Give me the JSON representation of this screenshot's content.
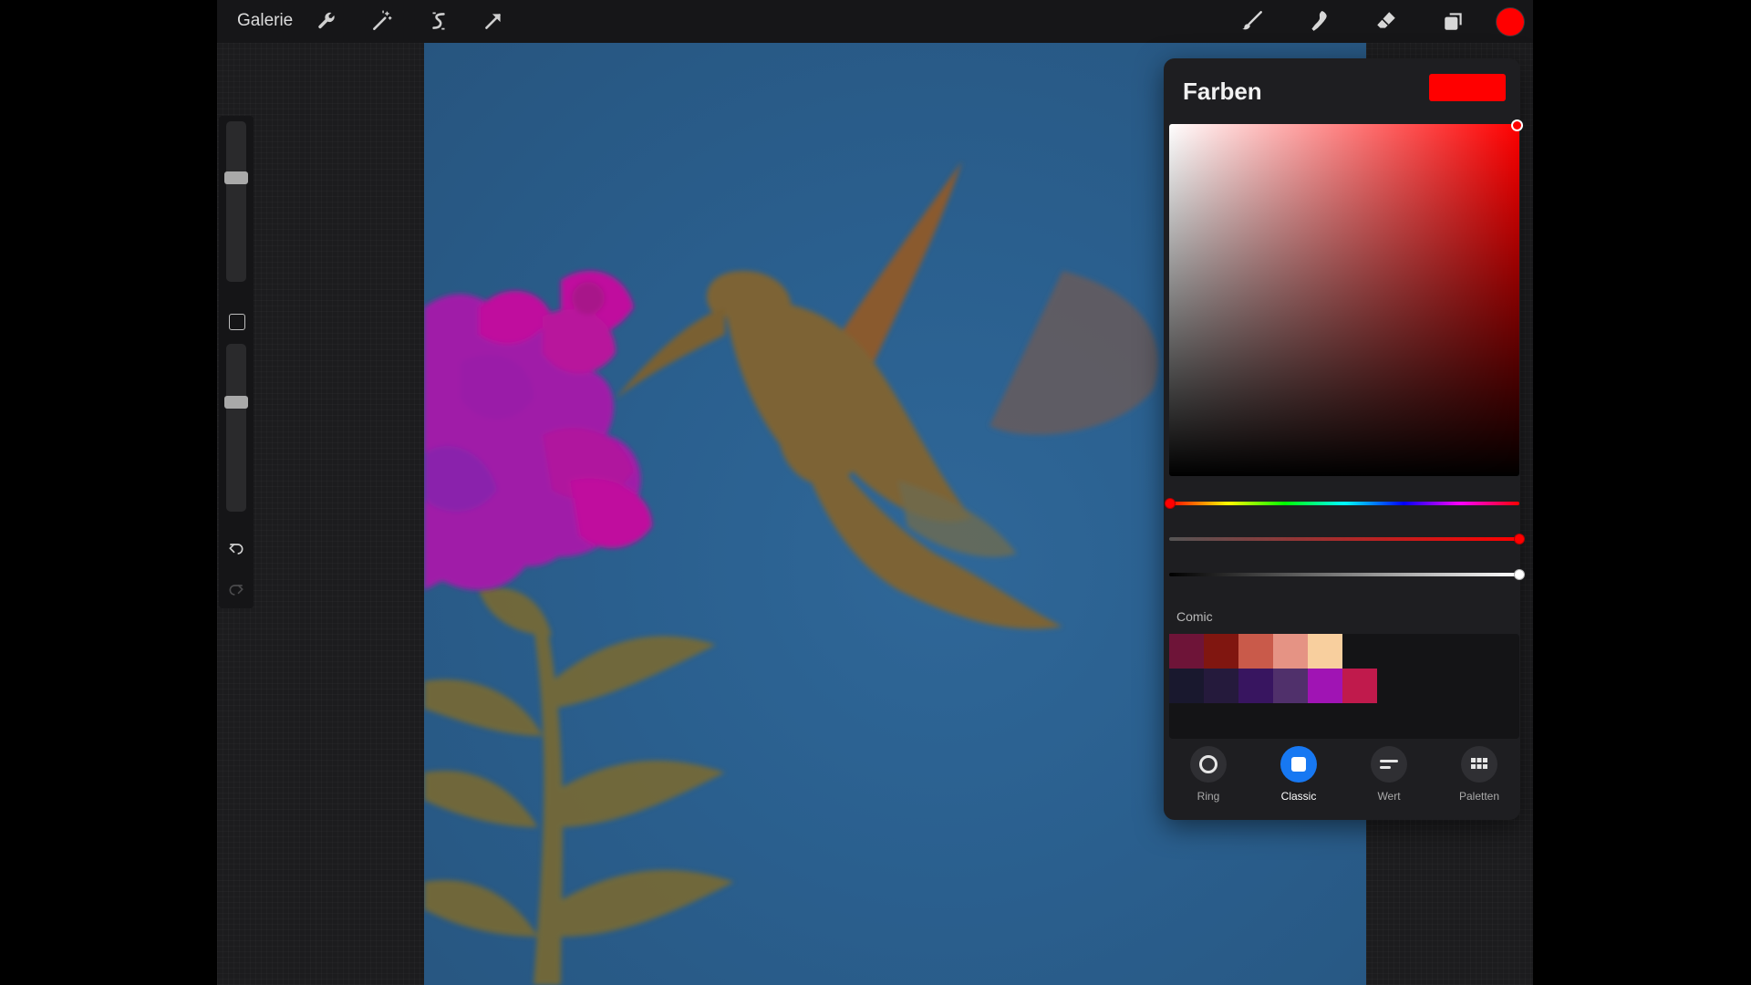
{
  "topbar": {
    "gallery_label": "Galerie",
    "left_tools": [
      "wrench-icon",
      "magic-wand-icon",
      "selection-s-icon",
      "transform-arrow-icon"
    ],
    "right_tools": [
      "brush-icon",
      "smudge-icon",
      "eraser-icon",
      "layers-icon"
    ],
    "current_color": "#ff0000"
  },
  "sidebar": {
    "brush_size_level": 0.35,
    "opacity_level": 0.35
  },
  "color_panel": {
    "title": "Farben",
    "current_color": "#ff0000",
    "hue_color": "#ff0000",
    "saturation": 1.0,
    "brightness": 1.0,
    "hue": 0.0,
    "palette": {
      "name": "Comic",
      "swatches": [
        [
          "#6e1438",
          "#801610",
          "#c95a4a",
          "#e59384",
          "#f8cf9e"
        ],
        [
          "#19182e",
          "#251a3c",
          "#381560",
          "#50306b",
          "#a014b4",
          "#c01a4c"
        ]
      ]
    },
    "modes": [
      {
        "label": "Ring",
        "icon": "ring-icon",
        "active": false
      },
      {
        "label": "Classic",
        "icon": "classic-square-icon",
        "active": true
      },
      {
        "label": "Wert",
        "icon": "value-sliders-icon",
        "active": false
      },
      {
        "label": "Paletten",
        "icon": "palettes-grid-icon",
        "active": false
      }
    ]
  }
}
